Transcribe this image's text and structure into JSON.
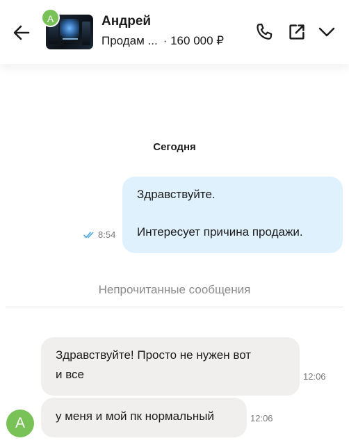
{
  "header": {
    "avatar_letter": "А",
    "contact_name": "Андрей",
    "listing_title": "Продам ...",
    "listing_price": "· 160 000 ₽",
    "icons": [
      "arrow-left-icon",
      "phone-icon",
      "external-link-icon",
      "chevron-down-icon"
    ]
  },
  "chat": {
    "date_label": "Сегодня",
    "outgoing": {
      "line1": "Здравствуйте.",
      "line2": "Интересует причина продажи.",
      "time": "8:54",
      "status_icon": "double-check-icon"
    },
    "unread_label": "Непрочитанные сообщения",
    "incoming": [
      {
        "line1": "Здравствуйте! Просто не нужен вот",
        "line2": "и все",
        "time": "12:06"
      },
      {
        "text": "у меня и мой пк нормальный",
        "time": "12:06"
      }
    ],
    "sender_avatar_letter": "А"
  },
  "colors": {
    "outgoing_bubble": "#dff1fd",
    "incoming_bubble": "#f1efed",
    "avatar": "#78c257",
    "read_check": "#4aa3e0"
  }
}
